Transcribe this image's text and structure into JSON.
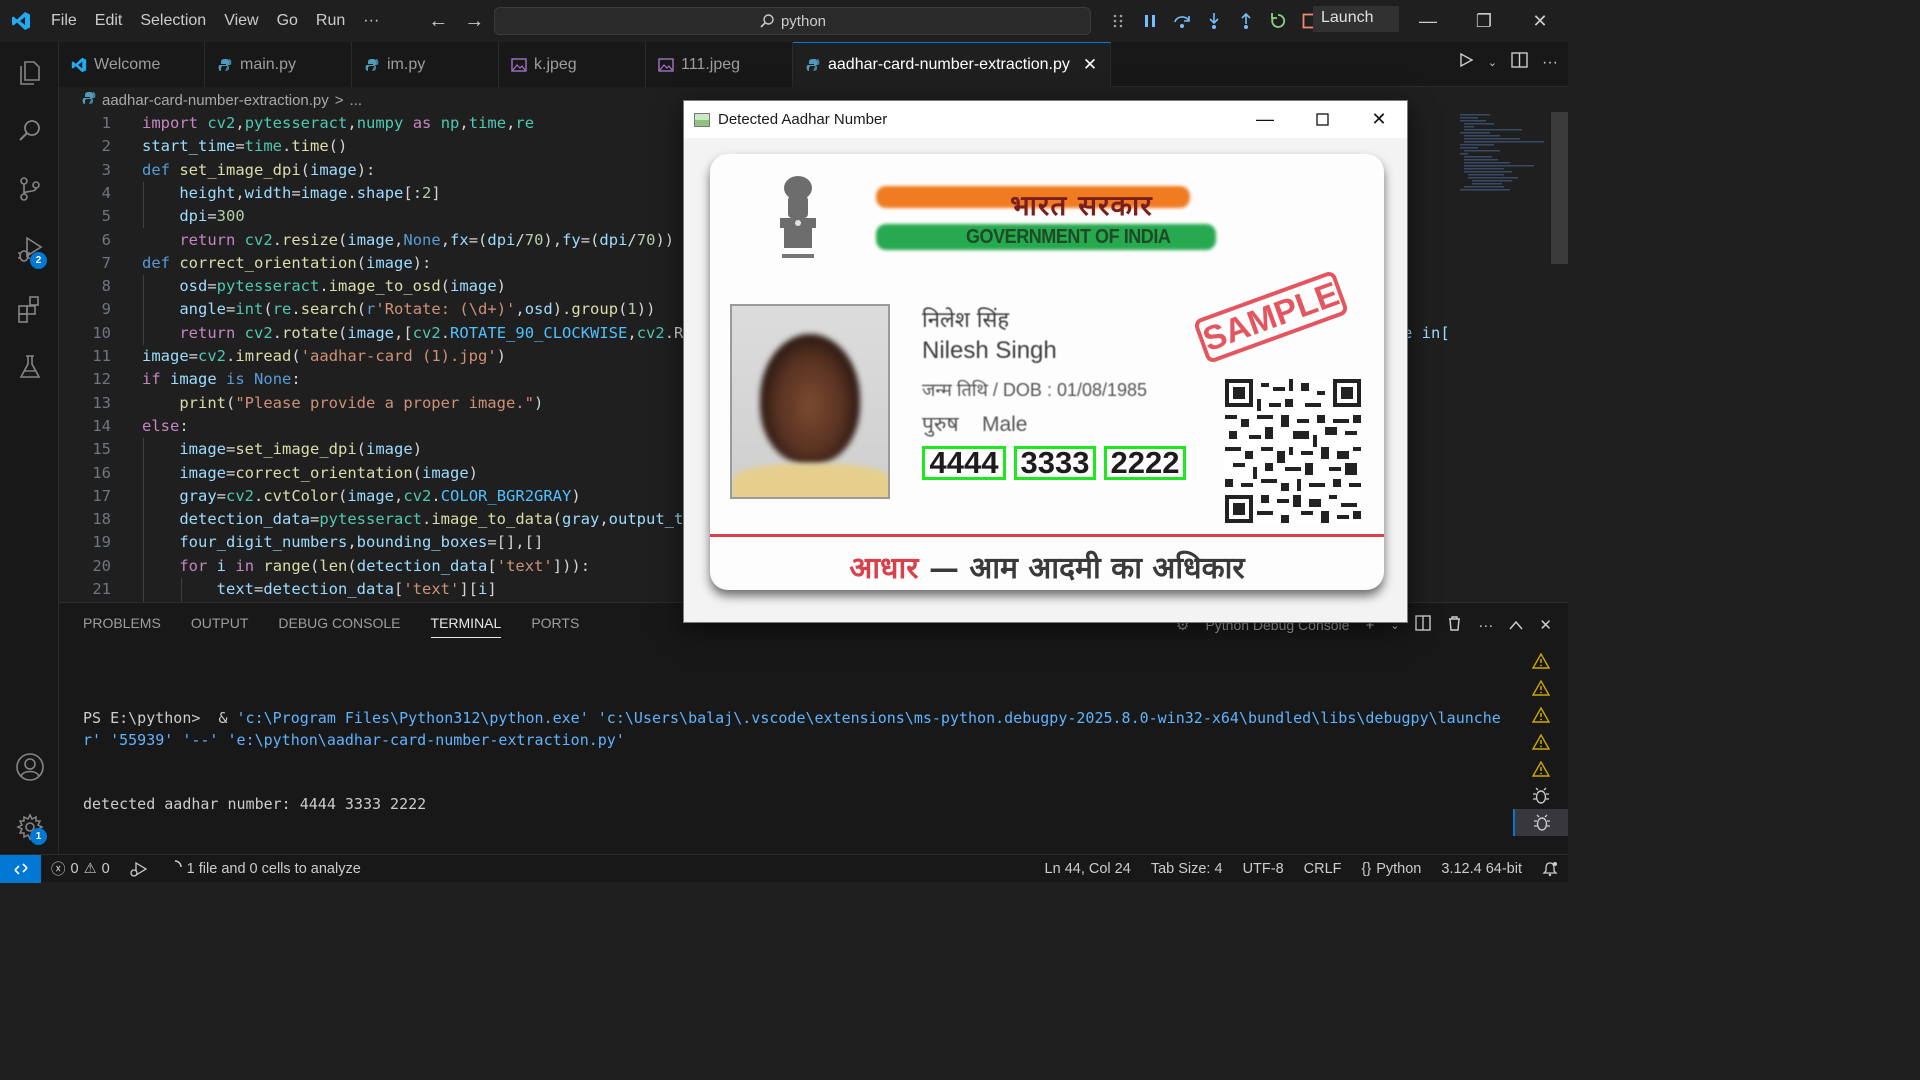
{
  "titlebar": {
    "menu": [
      "File",
      "Edit",
      "Selection",
      "View",
      "Go",
      "Run",
      "···"
    ],
    "search_text": "python",
    "launch_config": "Launch"
  },
  "tabs": [
    {
      "label": "Welcome",
      "icon": "vscode-logo-icon"
    },
    {
      "label": "main.py",
      "icon": "python-file-icon"
    },
    {
      "label": "im.py",
      "icon": "python-file-icon"
    },
    {
      "label": "k.jpeg",
      "icon": "image-file-icon"
    },
    {
      "label": "111.jpeg",
      "icon": "image-file-icon"
    },
    {
      "label": "aadhar-card-number-extraction.py",
      "icon": "python-file-icon",
      "active": true
    }
  ],
  "breadcrumb": {
    "file": "aadhar-card-number-extraction.py",
    "sep": ">",
    "rest": "..."
  },
  "editor": {
    "line_numbers": [
      "1",
      "2",
      "3",
      "4",
      "5",
      "6",
      "7",
      "8",
      "9",
      "10",
      "11",
      "12",
      "13",
      "14",
      "15",
      "16",
      "17",
      "18",
      "19",
      "20",
      "21"
    ],
    "overflow_line10_tail": "e in["
  },
  "panel": {
    "tabs": [
      "PROBLEMS",
      "OUTPUT",
      "DEBUG CONSOLE",
      "TERMINAL",
      "PORTS"
    ],
    "active_tab": "TERMINAL",
    "console_label": "Python Debug Console",
    "terminal": {
      "prompt": "PS E:\\python> ",
      "cmd_amp": " & ",
      "arg1": "'c:\\Program Files\\Python312\\python.exe'",
      "arg2": " 'c:\\Users\\balaj\\.vscode\\extensions\\ms-python.debugpy-2025.8.0-win32-x64\\bundled\\libs\\debugpy\\launcher' '55939' '--' 'e:\\python\\aadhar-card-number-extraction.py'",
      "output": "detected aadhar number: 4444 3333 2222"
    }
  },
  "statusbar": {
    "errors": "0",
    "warnings": "0",
    "analyze": "1 file and 0 cells to analyze",
    "position": "Ln 44, Col 24",
    "tab_size": "Tab Size: 4",
    "encoding": "UTF-8",
    "eol": "CRLF",
    "language": "Python",
    "interpreter": "3.12.4 64-bit"
  },
  "activity_badges": {
    "debug": "2",
    "settings": "1"
  },
  "popup": {
    "title": "Detected Aadhar Number",
    "card": {
      "hindi_gov": "भारत सरकार",
      "english_gov": "GOVERNMENT OF INDIA",
      "name_hindi": "निलेश सिंह",
      "name_english": "Nilesh Singh",
      "dob": "जन्म तिथि / DOB : 01/08/1985",
      "gender_hindi": "पुरुष",
      "gender_english": "Male",
      "number_groups": [
        "4444",
        "3333",
        "2222"
      ],
      "stamp": "SAMPLE",
      "footer_red": "आधार",
      "footer_rest": " — आम आदमी का अधिकार"
    }
  },
  "colors": {
    "accent": "#0078d4",
    "detection_box": "#1ee81e",
    "keyword": "#c586c0",
    "string": "#ce9178"
  }
}
